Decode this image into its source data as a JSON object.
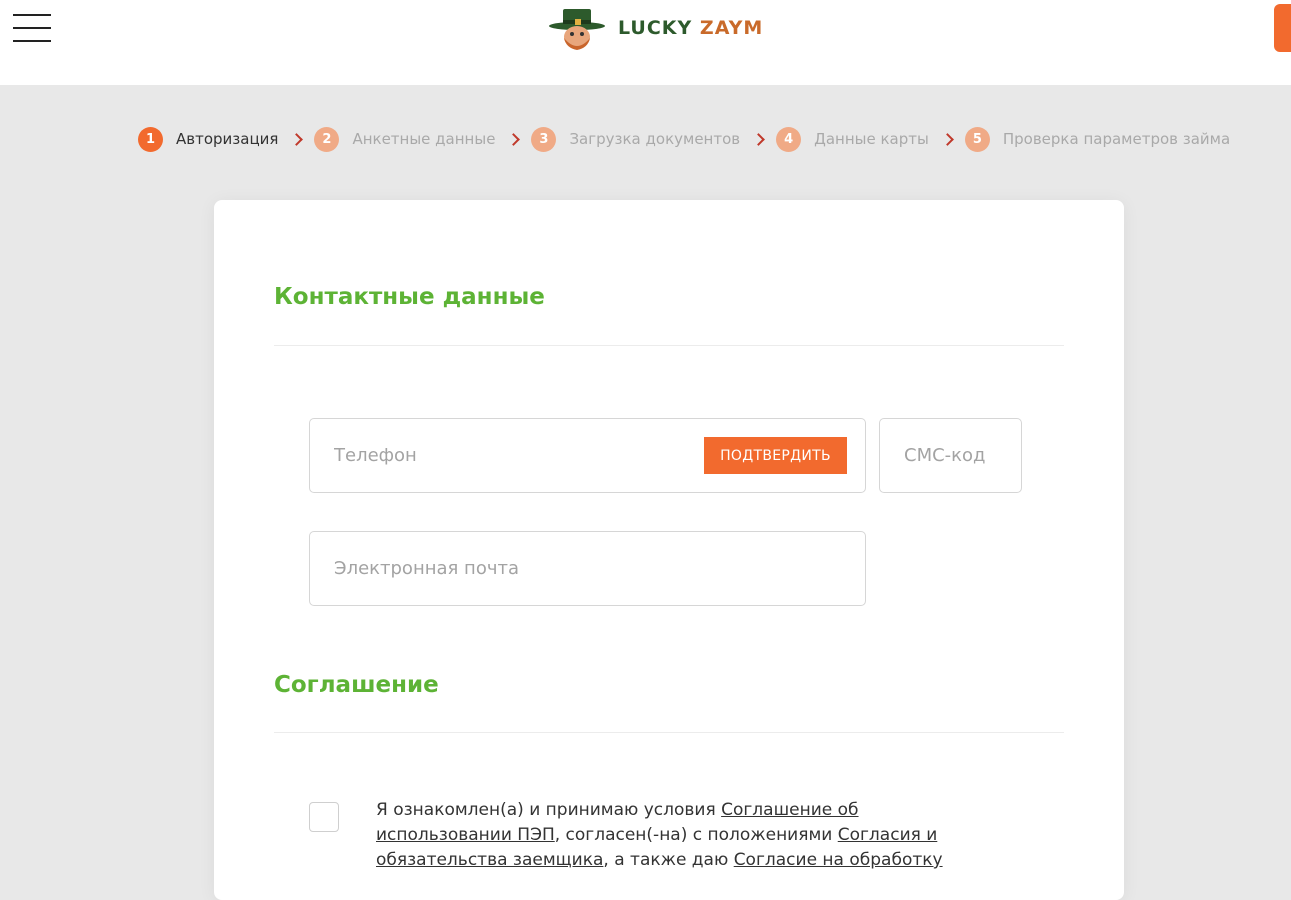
{
  "header": {
    "logo": {
      "lucky": "LUCKY",
      "zaym": "ZAYM"
    },
    "menu_icon": "burger-menu-icon"
  },
  "steps": [
    {
      "num": "1",
      "label": "Авторизация",
      "active": true
    },
    {
      "num": "2",
      "label": "Анкетные данные",
      "active": false
    },
    {
      "num": "3",
      "label": "Загрузка документов",
      "active": false
    },
    {
      "num": "4",
      "label": "Данные карты",
      "active": false
    },
    {
      "num": "5",
      "label": "Проверка параметров займа",
      "active": false
    }
  ],
  "contact": {
    "title": "Контактные данные",
    "phone_placeholder": "Телефон",
    "confirm_label": "ПОДТВЕРДИТЬ",
    "sms_placeholder": "СМС-код",
    "email_placeholder": "Электронная почта"
  },
  "agreement": {
    "title": "Соглашение",
    "text_1": "Я ознакомлен(а) и принимаю условия ",
    "link_1": "Соглашение об использовании ПЭП",
    "text_2": ", согласен(-на) с положениями ",
    "link_2": "Согласия и обязательства заемщика",
    "text_3": ", а также даю ",
    "link_3": "Согласие на обработку"
  },
  "colors": {
    "accent": "#f26a2e",
    "green": "#5db335",
    "step_inactive": "#f0aa86",
    "arrow": "#c0392b",
    "background": "#e8e8e8"
  }
}
